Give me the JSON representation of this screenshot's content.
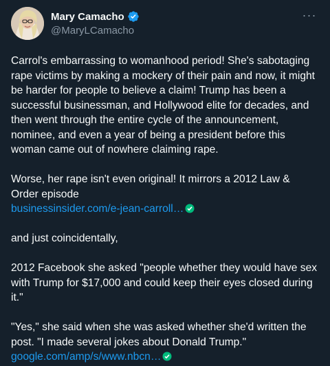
{
  "tweet": {
    "display_name": "Mary Camacho",
    "handle": "@MaryLCamacho",
    "more_label": "···",
    "paragraphs": [
      "Carrol's embarrassing to womanhood period! She's sabotaging rape victims by making a mockery of their pain and now, it might be harder for people to believe a claim! Trump has been a successful businessman, and Hollywood elite for decades, and then went through the entire cycle of the announcement, nominee, and even a year of being a president before this woman came out of nowhere claiming rape.",
      "Worse, her rape isn't even original! It mirrors a 2012 Law & Order episode",
      "and just coincidentally,",
      "2012 Facebook she asked \"people whether they would have sex with Trump for $17,000 and could keep their eyes closed during it.\"",
      "\"Yes,\" she said when she was asked whether she'd written the post. \"I made several jokes about Donald Trump.\""
    ],
    "links": [
      "businessinsider.com/e-jean-carroll…",
      "google.com/amp/s/www.nbcn…"
    ]
  },
  "colors": {
    "background": "#15202b",
    "text": "#f7f9f9",
    "secondary": "#8b98a5",
    "link": "#1d9bf0",
    "verified": "#1d9bf0",
    "check_badge": "#00ba7c"
  },
  "icons": {
    "verified": "verified-badge-icon",
    "more": "more-options-icon",
    "link_check": "link-verified-check-icon"
  }
}
